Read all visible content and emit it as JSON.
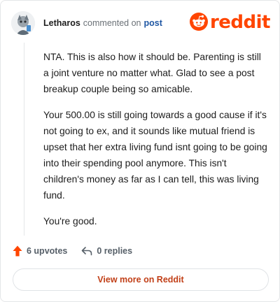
{
  "header": {
    "username": "Letharos",
    "action": "commented on",
    "post_link": "post",
    "logo_text": "reddit"
  },
  "comment": {
    "paragraphs": [
      "NTA. This is also how it should be. Parenting is still a joint venture no matter what. Glad to see a post breakup couple being so amicable.",
      "Your 500.00 is still going towards a good cause if it's not going to ex, and it sounds like mutual friend is upset that her extra living fund isnt going to be going into their spending pool anymore. This isn't children's money as far as I can tell, this was living fund.",
      "You're good."
    ]
  },
  "footer": {
    "upvotes": "6 upvotes",
    "replies": "0 replies"
  },
  "view_more": "View more on Reddit",
  "colors": {
    "brand": "#ff4500",
    "link": "#1f57a3",
    "cta_text": "#c13f17"
  },
  "icons": {
    "avatar": "user-avatar",
    "logo": "reddit-snoo-icon",
    "upvote": "upvote-arrow-icon",
    "reply": "reply-arrow-icon"
  }
}
